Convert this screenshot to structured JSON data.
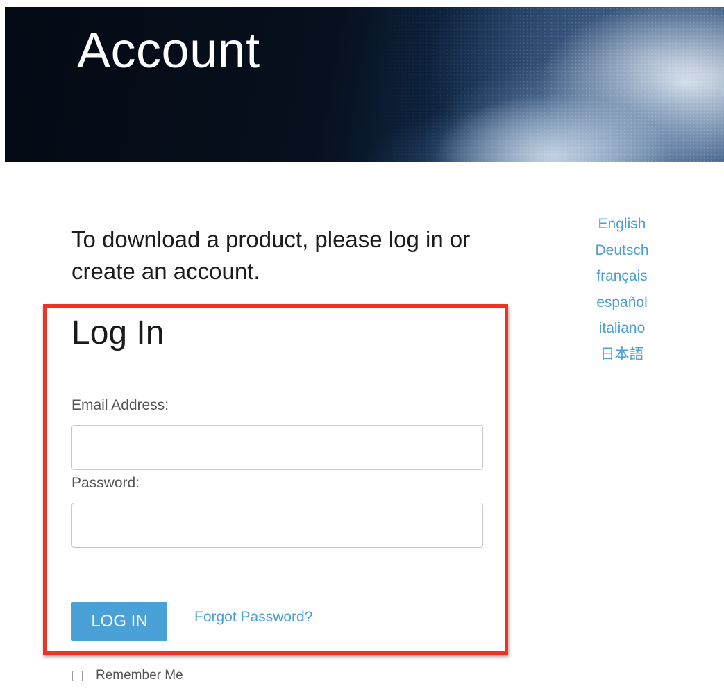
{
  "banner": {
    "title": "Account"
  },
  "intro": {
    "text": "To download a product, please log in or create an account."
  },
  "languages": [
    "English",
    "Deutsch",
    "français",
    "español",
    "italiano",
    "日本語"
  ],
  "login": {
    "heading": "Log In",
    "email_label": "Email Address:",
    "email_value": "",
    "password_label": "Password:",
    "password_value": "",
    "submit_label": "LOG IN",
    "forgot_label": "Forgot Password?",
    "remember_label": "Remember Me",
    "remember_checked": false
  },
  "colors": {
    "accent": "#4aa1d8",
    "highlight_border": "#ee3322",
    "banner_background": "#050b16"
  }
}
